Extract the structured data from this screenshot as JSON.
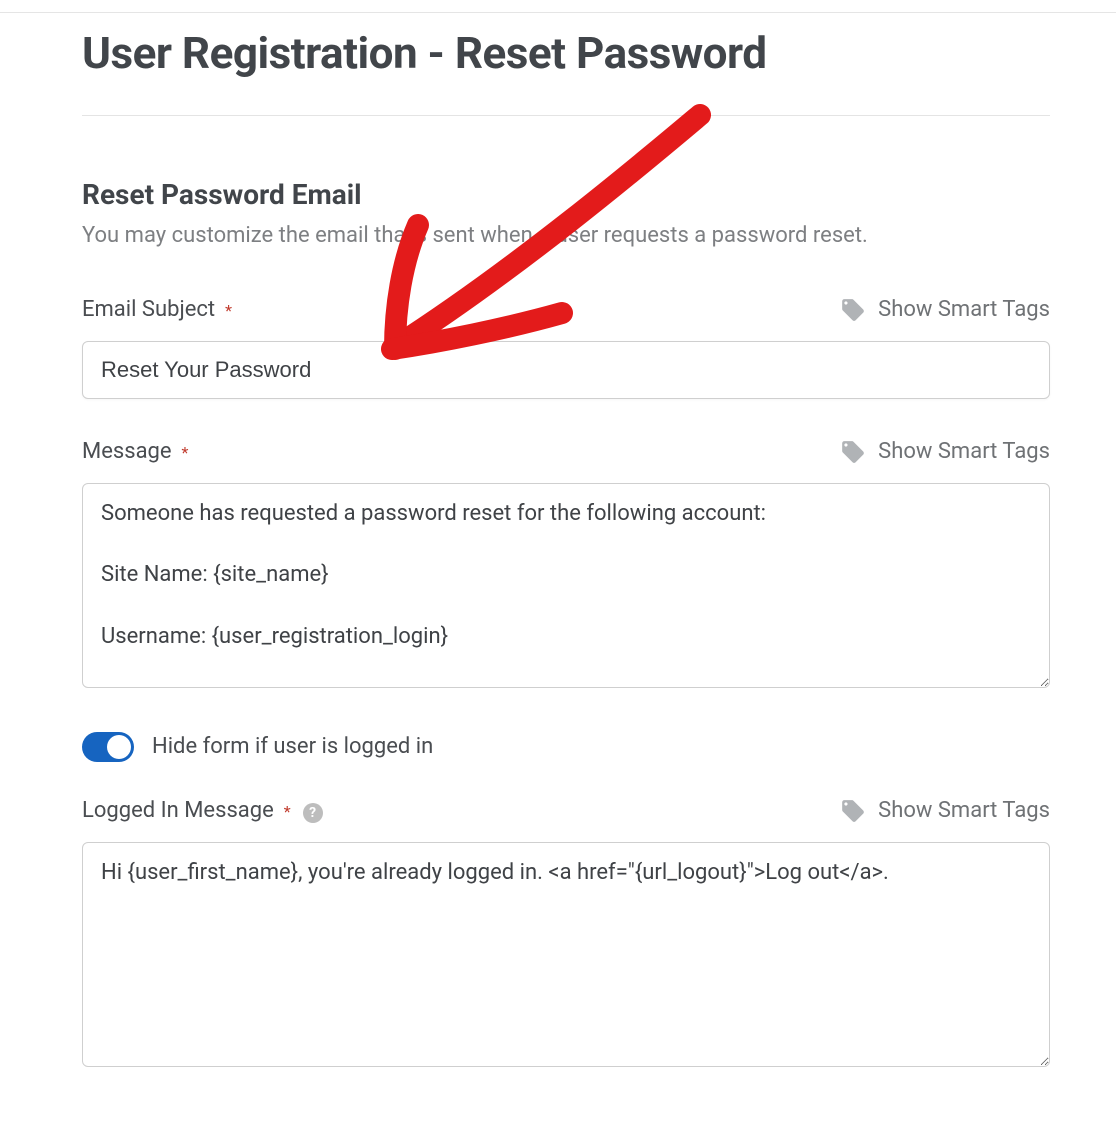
{
  "page": {
    "title": "User Registration - Reset Password"
  },
  "section": {
    "title": "Reset Password Email",
    "description": "You may customize the email that's sent when a user requests a password reset."
  },
  "fields": {
    "subject": {
      "label": "Email Subject",
      "value": "Reset Your Password"
    },
    "message": {
      "label": "Message",
      "value": "Someone has requested a password reset for the following account:\n\nSite Name: {site_name}\n\nUsername: {user_registration_login}"
    },
    "toggle": {
      "label": "Hide form if user is logged in",
      "enabled": true
    },
    "loggedInMessage": {
      "label": "Logged In Message",
      "value": "Hi {user_first_name}, you're already logged in. <a href=\"{url_logout}\">Log out</a>."
    }
  },
  "smartTags": {
    "label": "Show Smart Tags"
  },
  "annotation": {
    "arrow_color": "#e31b1b"
  }
}
